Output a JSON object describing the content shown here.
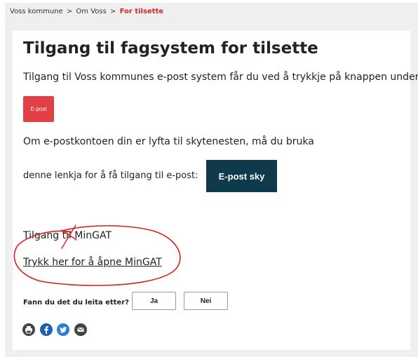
{
  "breadcrumb": {
    "items": [
      "Voss kommune",
      "Om Voss"
    ],
    "separator": ">",
    "current": "For tilsette"
  },
  "main": {
    "title": "Tilgang til fagsystem for tilsette",
    "intro_text": "Tilgang til Voss kommunes e-post system får du ved å trykkje på knappen under",
    "epost_button_label": "E-post",
    "cloud_text_1": "Om e-postkontoen din er lyfta til skytenesten, må du bruka",
    "cloud_text_2": "denne lenkja for å få tilgang til e-post:",
    "epost_sky_button_label": "E-post sky",
    "mingat_heading": "Tilgang til MinGAT",
    "mingat_link_label": "Trykk her for å åpne MinGAT"
  },
  "feedback": {
    "question": "Fann du det du leita etter?",
    "yes_label": "Ja",
    "no_label": "Nei"
  },
  "share": {
    "icons": [
      "print-icon",
      "facebook-icon",
      "twitter-icon",
      "email-icon"
    ]
  },
  "colors": {
    "accent_red": "#e04046",
    "breadcrumb_current": "#d6242b",
    "dark_button": "#0f3a4c",
    "annotation_red": "#d81e1e"
  }
}
